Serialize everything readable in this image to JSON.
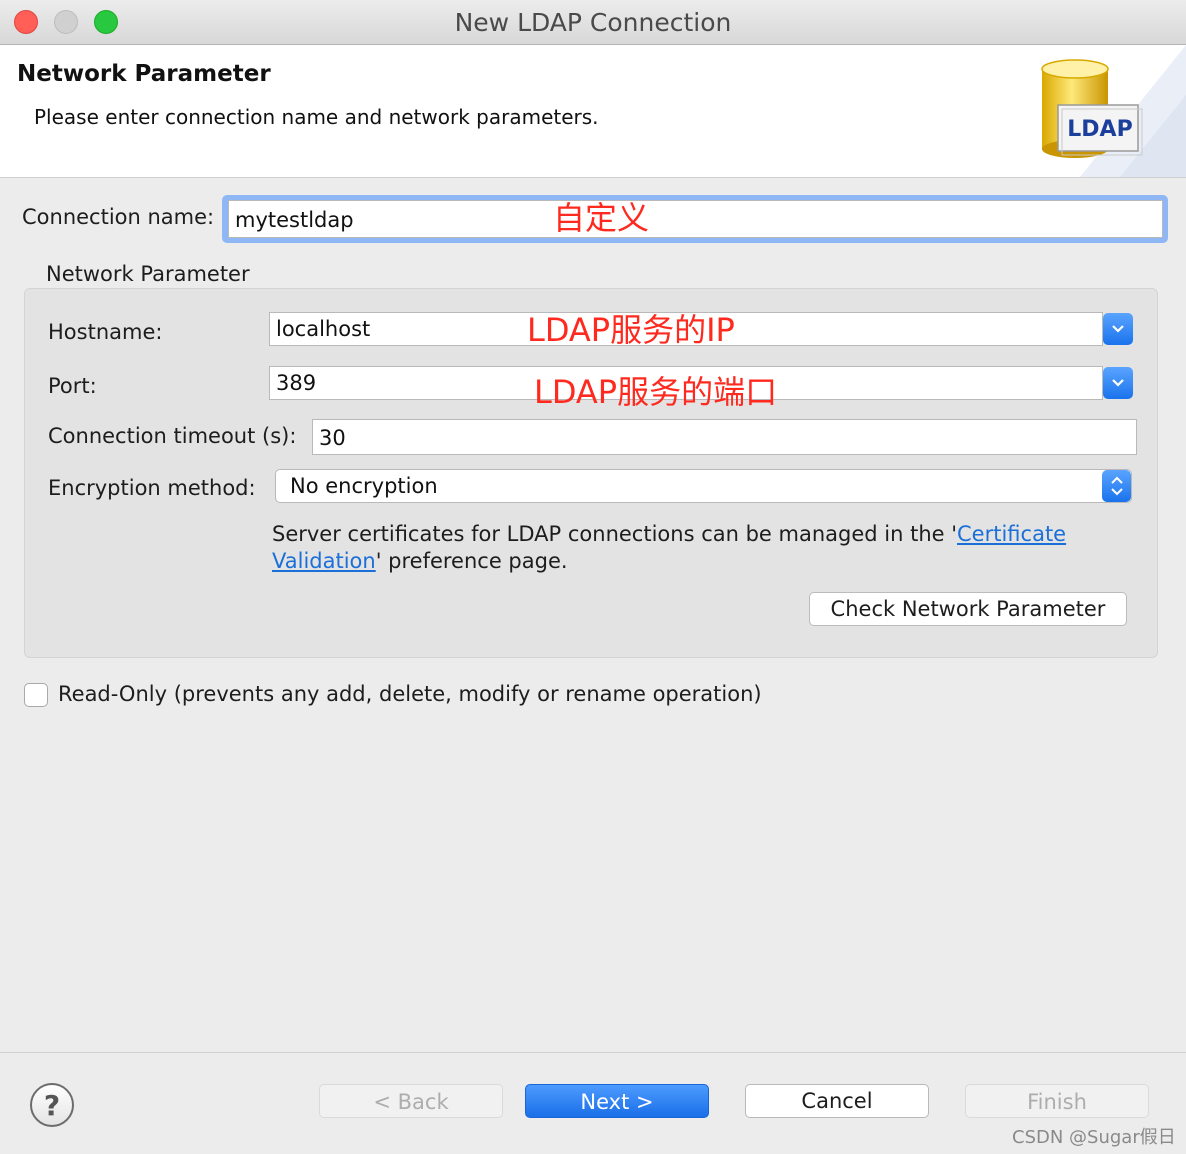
{
  "window": {
    "title": "New LDAP Connection",
    "close_color": "#ff5f57",
    "minimize_color": "#d0d0d0",
    "zoom_color": "#28c840"
  },
  "header": {
    "title": "Network Parameter",
    "subtitle": "Please enter connection name and network parameters.",
    "logo_text": "LDAP"
  },
  "connection": {
    "label": "Connection name:",
    "value": "mytestldap",
    "annotation": "自定义"
  },
  "network": {
    "group_label": "Network Parameter",
    "hostname": {
      "label": "Hostname:",
      "value": "localhost",
      "annotation": "LDAP服务的IP"
    },
    "port": {
      "label": "Port:",
      "value": "389",
      "annotation": "LDAP服务的端口"
    },
    "timeout": {
      "label": "Connection timeout (s):",
      "value": "30"
    },
    "encryption": {
      "label": "Encryption method:",
      "value": "No encryption"
    },
    "cert_text_before": "Server certificates for LDAP connections can be managed in the '",
    "cert_link_1": "Certificate",
    "cert_link_2": "Validation",
    "cert_text_after": "' preference page.",
    "check_button": "Check Network Parameter"
  },
  "readonly": {
    "label": "Read-Only (prevents any add, delete, modify or rename operation)",
    "checked": false
  },
  "footer": {
    "help": "?",
    "back": "< Back",
    "next": "Next >",
    "cancel": "Cancel",
    "finish": "Finish",
    "watermark": "CSDN @Sugar假日"
  },
  "colors": {
    "accent": "#1a73ec",
    "annotation": "#ff2a1f",
    "link": "#1a6fd8"
  }
}
